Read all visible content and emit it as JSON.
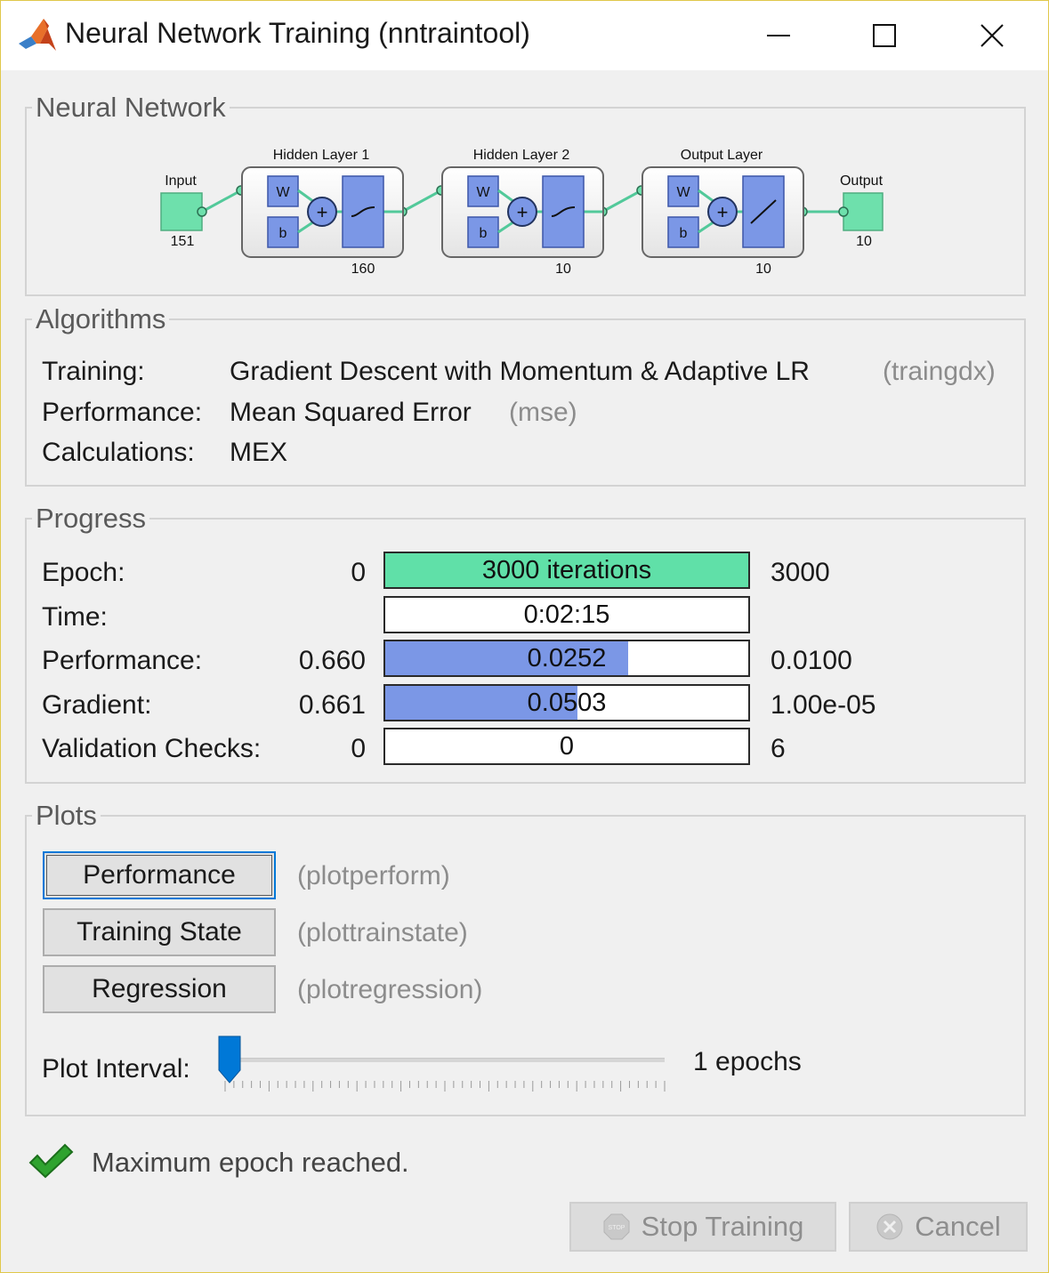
{
  "window": {
    "title": "Neural Network Training (nntraintool)"
  },
  "neural_network": {
    "legend": "Neural Network",
    "input": {
      "label": "Input",
      "size": "151"
    },
    "output": {
      "label": "Output",
      "size": "10"
    },
    "layers": [
      {
        "label": "Hidden Layer 1",
        "size": "160",
        "w": "W",
        "b": "b"
      },
      {
        "label": "Hidden Layer 2",
        "size": "10",
        "w": "W",
        "b": "b"
      },
      {
        "label": "Output Layer",
        "size": "10",
        "w": "W",
        "b": "b"
      }
    ]
  },
  "algorithms": {
    "legend": "Algorithms",
    "training_label": "Training:",
    "training_value": "Gradient Descent with Momentum & Adaptive LR",
    "training_fn": "(traingdx)",
    "performance_label": "Performance:",
    "performance_value": "Mean Squared Error",
    "performance_fn": "(mse)",
    "calculations_label": "Calculations:",
    "calculations_value": "MEX"
  },
  "progress": {
    "legend": "Progress",
    "rows": [
      {
        "label": "Epoch:",
        "start": "0",
        "bar_text": "3000 iterations",
        "end": "3000",
        "fill": 1.0,
        "fill_color": "#60e0a8"
      },
      {
        "label": "Time:",
        "start": "",
        "bar_text": "0:02:15",
        "end": "",
        "fill": 0,
        "fill_color": "#7b97e6"
      },
      {
        "label": "Performance:",
        "start": "0.660",
        "bar_text": "0.0252",
        "end": "0.0100",
        "fill": 0.67,
        "fill_color": "#7b97e6"
      },
      {
        "label": "Gradient:",
        "start": "0.661",
        "bar_text": "0.0503",
        "end": "1.00e-05",
        "fill": 0.53,
        "fill_color": "#7b97e6"
      },
      {
        "label": "Validation Checks:",
        "start": "0",
        "bar_text": "0",
        "end": "6",
        "fill": 0,
        "fill_color": "#7b97e6"
      }
    ]
  },
  "plots": {
    "legend": "Plots",
    "buttons": [
      {
        "label": "Performance",
        "fn": "(plotperform)"
      },
      {
        "label": "Training State",
        "fn": "(plottrainstate)"
      },
      {
        "label": "Regression",
        "fn": "(plotregression)"
      }
    ],
    "interval_label": "Plot Interval:",
    "interval_value": "1 epochs",
    "slider_fraction": 0.0
  },
  "status": {
    "message": "Maximum epoch reached.",
    "icon": "checkmark-icon"
  },
  "buttons": {
    "stop_label": "Stop Training",
    "stop_icon": "stop-icon",
    "cancel_label": "Cancel",
    "cancel_icon": "cancel-icon"
  },
  "colors": {
    "accent_green": "#60e0a8",
    "accent_blue": "#7b97e6",
    "slider_blue": "#0078d7"
  }
}
